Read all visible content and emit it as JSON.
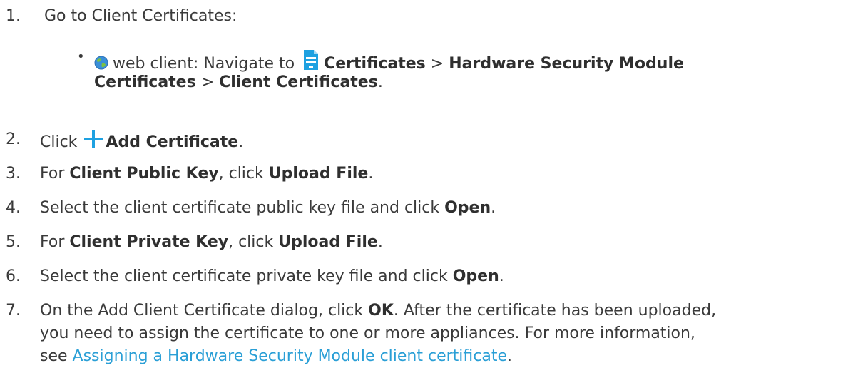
{
  "steps": [
    {
      "num": "1.",
      "text": "Go to Client Certificates:",
      "sub": {
        "prefix": "web client: Navigate to",
        "b1": "Certificates",
        "sep1": ">",
        "b2": "Hardware Security Module",
        "b3": "Certificates",
        "sep2": ">",
        "b4": "Client Certificates",
        "end": "."
      }
    },
    {
      "num": "2.",
      "pre": "Click",
      "b1": "Add Certificate",
      "post": "."
    },
    {
      "num": "3.",
      "pre": "For",
      "b1": "Client Public Key",
      "mid": ", click",
      "b2": "Upload File",
      "post": "."
    },
    {
      "num": "4.",
      "pre": "Select the client certificate public key file and click",
      "b1": "Open",
      "post": "."
    },
    {
      "num": "5.",
      "pre": "For",
      "b1": "Client Private Key",
      "mid": ", click",
      "b2": "Upload File",
      "post": "."
    },
    {
      "num": "6.",
      "pre": "Select the client certificate private key file and click",
      "b1": "Open",
      "post": "."
    },
    {
      "num": "7.",
      "pre": "On the Add Client Certificate dialog, click",
      "b1": "OK",
      "post": ". After the certificate has been uploaded,",
      "line2": "you need to assign the certificate to one or more appliances. For more information,",
      "line3_pre": "see",
      "link": "Assigning a Hardware Security Module client certificate",
      "line3_post": "."
    }
  ],
  "colors": {
    "text": "#3a3a3a",
    "link": "#2a9fd6",
    "accent": "#1ea1e1"
  },
  "icons": {
    "globe": "globe-icon",
    "certificate": "certificate-icon",
    "plus": "plus-icon"
  }
}
